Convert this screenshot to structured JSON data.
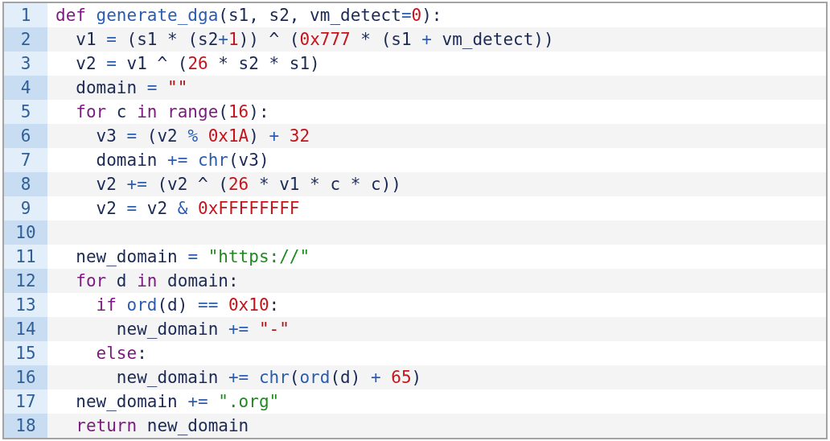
{
  "code_lines": [
    {
      "number": "1",
      "tokens": [
        {
          "kind": "keyword",
          "text": "def"
        },
        {
          "kind": "function",
          "text": " generate_dga"
        },
        {
          "kind": "plain",
          "text": "(s1, s2, vm_detect"
        },
        {
          "kind": "operator",
          "text": "="
        },
        {
          "kind": "number",
          "text": "0"
        },
        {
          "kind": "plain",
          "text": "):"
        }
      ]
    },
    {
      "number": "2",
      "tokens": [
        {
          "kind": "plain",
          "text": "  v1 "
        },
        {
          "kind": "operator",
          "text": "="
        },
        {
          "kind": "plain",
          "text": " (s1 * (s2"
        },
        {
          "kind": "operator",
          "text": "+"
        },
        {
          "kind": "number",
          "text": "1"
        },
        {
          "kind": "plain",
          "text": ")) ^ ("
        },
        {
          "kind": "number",
          "text": "0x777"
        },
        {
          "kind": "plain",
          "text": " * (s1 "
        },
        {
          "kind": "operator",
          "text": "+"
        },
        {
          "kind": "plain",
          "text": " vm_detect))"
        }
      ]
    },
    {
      "number": "3",
      "tokens": [
        {
          "kind": "plain",
          "text": "  v2 "
        },
        {
          "kind": "operator",
          "text": "="
        },
        {
          "kind": "plain",
          "text": " v1 ^ ("
        },
        {
          "kind": "number",
          "text": "26"
        },
        {
          "kind": "plain",
          "text": " * s2 * s1)"
        }
      ]
    },
    {
      "number": "4",
      "tokens": [
        {
          "kind": "plain",
          "text": "  domain "
        },
        {
          "kind": "operator",
          "text": "="
        },
        {
          "kind": "literal",
          "text": " \"\""
        }
      ]
    },
    {
      "number": "5",
      "tokens": [
        {
          "kind": "keyword",
          "text": "  for"
        },
        {
          "kind": "plain",
          "text": " c "
        },
        {
          "kind": "keyword",
          "text": "in range"
        },
        {
          "kind": "plain",
          "text": "("
        },
        {
          "kind": "number",
          "text": "16"
        },
        {
          "kind": "plain",
          "text": "):"
        }
      ]
    },
    {
      "number": "6",
      "tokens": [
        {
          "kind": "plain",
          "text": "    v3 "
        },
        {
          "kind": "operator",
          "text": "="
        },
        {
          "kind": "plain",
          "text": " (v2 "
        },
        {
          "kind": "operator",
          "text": "%"
        },
        {
          "kind": "number",
          "text": " 0x1A"
        },
        {
          "kind": "plain",
          "text": ") "
        },
        {
          "kind": "operator",
          "text": "+"
        },
        {
          "kind": "number",
          "text": " 32"
        }
      ]
    },
    {
      "number": "7",
      "tokens": [
        {
          "kind": "plain",
          "text": "    domain "
        },
        {
          "kind": "operator",
          "text": "+="
        },
        {
          "kind": "function",
          "text": " chr"
        },
        {
          "kind": "plain",
          "text": "(v3)"
        }
      ]
    },
    {
      "number": "8",
      "tokens": [
        {
          "kind": "plain",
          "text": "    v2 "
        },
        {
          "kind": "operator",
          "text": "+="
        },
        {
          "kind": "plain",
          "text": " (v2 ^ ("
        },
        {
          "kind": "number",
          "text": "26"
        },
        {
          "kind": "plain",
          "text": " * v1 * c * c))"
        }
      ]
    },
    {
      "number": "9",
      "tokens": [
        {
          "kind": "plain",
          "text": "    v2 "
        },
        {
          "kind": "operator",
          "text": "="
        },
        {
          "kind": "plain",
          "text": " v2 "
        },
        {
          "kind": "operator",
          "text": "&"
        },
        {
          "kind": "number",
          "text": " 0xFFFFFFFF"
        }
      ]
    },
    {
      "number": "10"
    },
    {
      "number": "11",
      "tokens": [
        {
          "kind": "plain",
          "text": "  new_domain "
        },
        {
          "kind": "operator",
          "text": "="
        },
        {
          "kind": "string",
          "text": " \"https://\""
        }
      ]
    },
    {
      "number": "12",
      "tokens": [
        {
          "kind": "keyword",
          "text": "  for"
        },
        {
          "kind": "plain",
          "text": " d "
        },
        {
          "kind": "keyword",
          "text": "in"
        },
        {
          "kind": "plain",
          "text": " domain:"
        }
      ]
    },
    {
      "number": "13",
      "tokens": [
        {
          "kind": "keyword",
          "text": "    if"
        },
        {
          "kind": "function",
          "text": " ord"
        },
        {
          "kind": "plain",
          "text": "(d) "
        },
        {
          "kind": "operator",
          "text": "=="
        },
        {
          "kind": "number",
          "text": " 0x10"
        },
        {
          "kind": "plain",
          "text": ":"
        }
      ]
    },
    {
      "number": "14",
      "tokens": [
        {
          "kind": "plain",
          "text": "      new_domain "
        },
        {
          "kind": "operator",
          "text": "+="
        },
        {
          "kind": "literal",
          "text": " \"-\""
        }
      ]
    },
    {
      "number": "15",
      "tokens": [
        {
          "kind": "keyword",
          "text": "    else"
        },
        {
          "kind": "plain",
          "text": ":"
        }
      ]
    },
    {
      "number": "16",
      "tokens": [
        {
          "kind": "plain",
          "text": "      new_domain "
        },
        {
          "kind": "operator",
          "text": "+="
        },
        {
          "kind": "function",
          "text": " chr"
        },
        {
          "kind": "plain",
          "text": "("
        },
        {
          "kind": "function",
          "text": "ord"
        },
        {
          "kind": "plain",
          "text": "(d) "
        },
        {
          "kind": "operator",
          "text": "+"
        },
        {
          "kind": "number",
          "text": " 65"
        },
        {
          "kind": "plain",
          "text": ")"
        }
      ]
    },
    {
      "number": "17",
      "tokens": [
        {
          "kind": "plain",
          "text": "  new_domain "
        },
        {
          "kind": "operator",
          "text": "+="
        },
        {
          "kind": "string",
          "text": " \".org\""
        }
      ]
    },
    {
      "number": "18",
      "tokens": [
        {
          "kind": "keyword",
          "text": "  return"
        },
        {
          "kind": "plain",
          "text": " new_domain"
        }
      ]
    }
  ]
}
